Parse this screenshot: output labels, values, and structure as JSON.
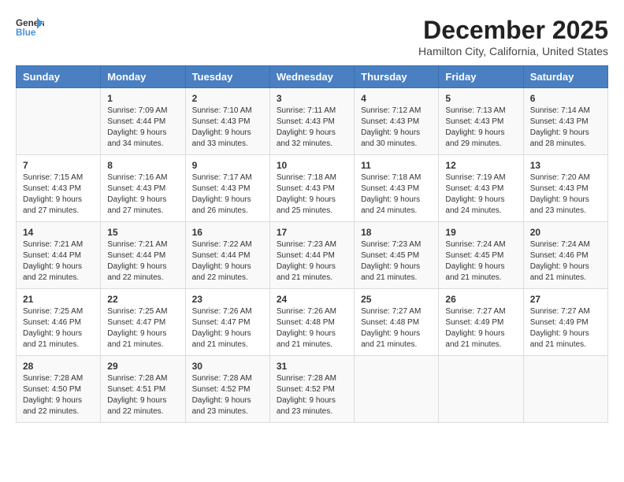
{
  "header": {
    "logo_line1": "General",
    "logo_line2": "Blue",
    "month_title": "December 2025",
    "location": "Hamilton City, California, United States"
  },
  "days_of_week": [
    "Sunday",
    "Monday",
    "Tuesday",
    "Wednesday",
    "Thursday",
    "Friday",
    "Saturday"
  ],
  "weeks": [
    [
      {
        "day": "",
        "info": ""
      },
      {
        "day": "1",
        "info": "Sunrise: 7:09 AM\nSunset: 4:44 PM\nDaylight: 9 hours\nand 34 minutes."
      },
      {
        "day": "2",
        "info": "Sunrise: 7:10 AM\nSunset: 4:43 PM\nDaylight: 9 hours\nand 33 minutes."
      },
      {
        "day": "3",
        "info": "Sunrise: 7:11 AM\nSunset: 4:43 PM\nDaylight: 9 hours\nand 32 minutes."
      },
      {
        "day": "4",
        "info": "Sunrise: 7:12 AM\nSunset: 4:43 PM\nDaylight: 9 hours\nand 30 minutes."
      },
      {
        "day": "5",
        "info": "Sunrise: 7:13 AM\nSunset: 4:43 PM\nDaylight: 9 hours\nand 29 minutes."
      },
      {
        "day": "6",
        "info": "Sunrise: 7:14 AM\nSunset: 4:43 PM\nDaylight: 9 hours\nand 28 minutes."
      }
    ],
    [
      {
        "day": "7",
        "info": "Sunrise: 7:15 AM\nSunset: 4:43 PM\nDaylight: 9 hours\nand 27 minutes."
      },
      {
        "day": "8",
        "info": "Sunrise: 7:16 AM\nSunset: 4:43 PM\nDaylight: 9 hours\nand 27 minutes."
      },
      {
        "day": "9",
        "info": "Sunrise: 7:17 AM\nSunset: 4:43 PM\nDaylight: 9 hours\nand 26 minutes."
      },
      {
        "day": "10",
        "info": "Sunrise: 7:18 AM\nSunset: 4:43 PM\nDaylight: 9 hours\nand 25 minutes."
      },
      {
        "day": "11",
        "info": "Sunrise: 7:18 AM\nSunset: 4:43 PM\nDaylight: 9 hours\nand 24 minutes."
      },
      {
        "day": "12",
        "info": "Sunrise: 7:19 AM\nSunset: 4:43 PM\nDaylight: 9 hours\nand 24 minutes."
      },
      {
        "day": "13",
        "info": "Sunrise: 7:20 AM\nSunset: 4:43 PM\nDaylight: 9 hours\nand 23 minutes."
      }
    ],
    [
      {
        "day": "14",
        "info": "Sunrise: 7:21 AM\nSunset: 4:44 PM\nDaylight: 9 hours\nand 22 minutes."
      },
      {
        "day": "15",
        "info": "Sunrise: 7:21 AM\nSunset: 4:44 PM\nDaylight: 9 hours\nand 22 minutes."
      },
      {
        "day": "16",
        "info": "Sunrise: 7:22 AM\nSunset: 4:44 PM\nDaylight: 9 hours\nand 22 minutes."
      },
      {
        "day": "17",
        "info": "Sunrise: 7:23 AM\nSunset: 4:44 PM\nDaylight: 9 hours\nand 21 minutes."
      },
      {
        "day": "18",
        "info": "Sunrise: 7:23 AM\nSunset: 4:45 PM\nDaylight: 9 hours\nand 21 minutes."
      },
      {
        "day": "19",
        "info": "Sunrise: 7:24 AM\nSunset: 4:45 PM\nDaylight: 9 hours\nand 21 minutes."
      },
      {
        "day": "20",
        "info": "Sunrise: 7:24 AM\nSunset: 4:46 PM\nDaylight: 9 hours\nand 21 minutes."
      }
    ],
    [
      {
        "day": "21",
        "info": "Sunrise: 7:25 AM\nSunset: 4:46 PM\nDaylight: 9 hours\nand 21 minutes."
      },
      {
        "day": "22",
        "info": "Sunrise: 7:25 AM\nSunset: 4:47 PM\nDaylight: 9 hours\nand 21 minutes."
      },
      {
        "day": "23",
        "info": "Sunrise: 7:26 AM\nSunset: 4:47 PM\nDaylight: 9 hours\nand 21 minutes."
      },
      {
        "day": "24",
        "info": "Sunrise: 7:26 AM\nSunset: 4:48 PM\nDaylight: 9 hours\nand 21 minutes."
      },
      {
        "day": "25",
        "info": "Sunrise: 7:27 AM\nSunset: 4:48 PM\nDaylight: 9 hours\nand 21 minutes."
      },
      {
        "day": "26",
        "info": "Sunrise: 7:27 AM\nSunset: 4:49 PM\nDaylight: 9 hours\nand 21 minutes."
      },
      {
        "day": "27",
        "info": "Sunrise: 7:27 AM\nSunset: 4:49 PM\nDaylight: 9 hours\nand 21 minutes."
      }
    ],
    [
      {
        "day": "28",
        "info": "Sunrise: 7:28 AM\nSunset: 4:50 PM\nDaylight: 9 hours\nand 22 minutes."
      },
      {
        "day": "29",
        "info": "Sunrise: 7:28 AM\nSunset: 4:51 PM\nDaylight: 9 hours\nand 22 minutes."
      },
      {
        "day": "30",
        "info": "Sunrise: 7:28 AM\nSunset: 4:52 PM\nDaylight: 9 hours\nand 23 minutes."
      },
      {
        "day": "31",
        "info": "Sunrise: 7:28 AM\nSunset: 4:52 PM\nDaylight: 9 hours\nand 23 minutes."
      },
      {
        "day": "",
        "info": ""
      },
      {
        "day": "",
        "info": ""
      },
      {
        "day": "",
        "info": ""
      }
    ]
  ]
}
